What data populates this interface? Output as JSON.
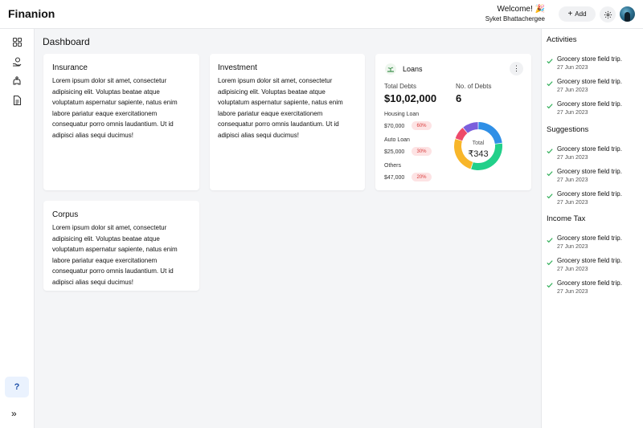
{
  "app": {
    "title": "Finanion"
  },
  "header": {
    "welcome": "Welcome! 🎉",
    "user_name": "Syket Bhattachergee",
    "add_label": "Add"
  },
  "sidebar": {
    "icons": [
      "dashboard-icon",
      "money-hand-icon",
      "piggy-bank-icon",
      "document-icon"
    ],
    "help_label": "?",
    "expand_label": "»"
  },
  "page": {
    "title": "Dashboard"
  },
  "cards": {
    "insurance": {
      "title": "Insurance",
      "body": "Lorem ipsum dolor sit amet, consectetur adipisicing elit. Voluptas beatae atque voluptatum aspernatur sapiente, natus enim labore pariatur eaque exercitationem consequatur porro omnis laudantium. Ut id adipisci alias sequi ducimus!"
    },
    "investment": {
      "title": "Investment",
      "body": "Lorem ipsum dolor sit amet, consectetur adipisicing elit. Voluptas beatae atque voluptatum aspernatur sapiente, natus enim labore pariatur eaque exercitationem consequatur porro omnis laudantium. Ut id adipisci alias sequi ducimus!"
    },
    "corpus": {
      "title": "Corpus",
      "body": "Lorem ipsum dolor sit amet, consectetur adipisicing elit. Voluptas beatae atque voluptatum aspernatur sapiente, natus enim labore pariatur eaque exercitationem consequatur porro omnis laudantium. Ut id adipisci alias sequi ducimus!"
    }
  },
  "loans": {
    "title": "Loans",
    "menu_label": "⋮",
    "total_debts_label": "Total Debts",
    "total_debts_value": "$10,02,000",
    "num_debts_label": "No. of Debts",
    "num_debts_value": "6",
    "items": [
      {
        "name": "Housing Loan",
        "amount": "$70,000",
        "percent": "60%"
      },
      {
        "name": "Auto Loan",
        "amount": "$25,000",
        "percent": "30%"
      },
      {
        "name": "Others",
        "amount": "$47,000",
        "percent": "20%"
      }
    ],
    "donut": {
      "center_label": "Total",
      "center_value": "₹343",
      "segments": [
        {
          "value": 23,
          "color": "#2f8fe6"
        },
        {
          "value": 32,
          "color": "#22d08a"
        },
        {
          "value": 25,
          "color": "#f8b62a"
        },
        {
          "value": 9,
          "color": "#ee4a6a"
        },
        {
          "value": 11,
          "color": "#7b5fdc"
        }
      ]
    }
  },
  "colors": {
    "check": "#2fae57",
    "badge_bg": "#fde3e4",
    "badge_text": "#d83b3b"
  },
  "right_panel": {
    "sections": [
      {
        "title": "Activities",
        "items": [
          {
            "title": "Grocery store field trip.",
            "date": "27 Jun 2023"
          },
          {
            "title": "Grocery store field trip.",
            "date": "27 Jun 2023"
          },
          {
            "title": "Grocery store field trip.",
            "date": "27 Jun 2023"
          }
        ]
      },
      {
        "title": "Suggestions",
        "items": [
          {
            "title": "Grocery store field trip.",
            "date": "27 Jun 2023"
          },
          {
            "title": "Grocery store field trip.",
            "date": "27 Jun 2023"
          },
          {
            "title": "Grocery store field trip.",
            "date": "27 Jun 2023"
          }
        ]
      },
      {
        "title": "Income Tax",
        "items": [
          {
            "title": "Grocery store field trip.",
            "date": "27 Jun 2023"
          },
          {
            "title": "Grocery store field trip.",
            "date": "27 Jun 2023"
          },
          {
            "title": "Grocery store field trip.",
            "date": "27 Jun 2023"
          }
        ]
      }
    ]
  }
}
